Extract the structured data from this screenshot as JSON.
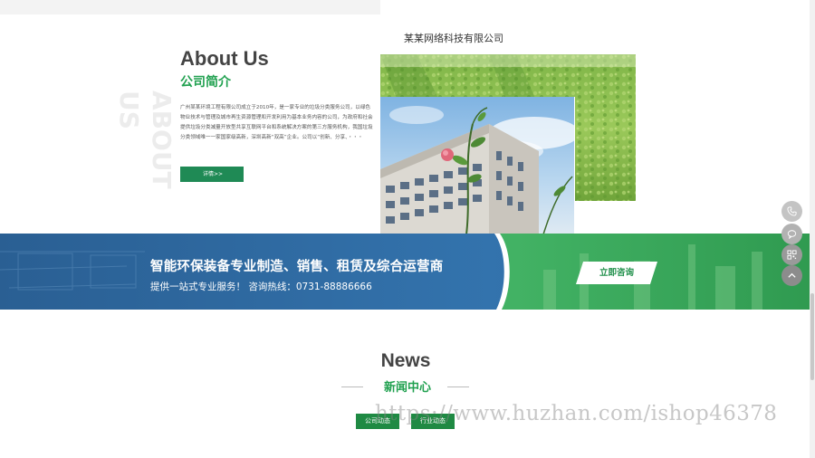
{
  "about": {
    "vertical_watermark": "ABOUT US",
    "title_en": "About Us",
    "title_zh": "公司简介",
    "description": "广州某某环境工程有限公司成立于2010年，是一家专业的垃圾分类服务公司，以绿色物业技术与管理及城市再生资源管理和开发利用为基本业务内容的公司，为政府和社会提供垃圾分类减量开放型共享互联网平台和系统解决方案的第三方服务机构，我国垃圾分类领域唯一一家国家级高新，深圳高新“双高”企业。公司以“创新、分享、・・・",
    "detail_button": "详情>>",
    "company_name": "某某网络科技有限公司"
  },
  "banner": {
    "title": "智能环保装备专业制造、销售、租赁及综合运营商",
    "subtitle": "提供一站式专业服务！  咨询热线：0731-88886666",
    "consult_button": "立即咨询"
  },
  "float_tools": [
    {
      "icon": "phone-icon"
    },
    {
      "icon": "chat-icon"
    },
    {
      "icon": "qrcode-icon"
    },
    {
      "icon": "back-to-top-icon"
    }
  ],
  "news": {
    "title_en": "News",
    "title_zh": "新闻中心",
    "tabs": [
      {
        "label": "公司动态"
      },
      {
        "label": "行业动态"
      }
    ]
  },
  "watermark_url": "https://www.huzhan.com/ishop46378",
  "colors": {
    "brand_green": "#21a150",
    "button_green": "#1f8a55",
    "banner_blue": "#2f6ea8",
    "banner_green": "#3aa85c",
    "float_gray": "#b9b9b9"
  }
}
